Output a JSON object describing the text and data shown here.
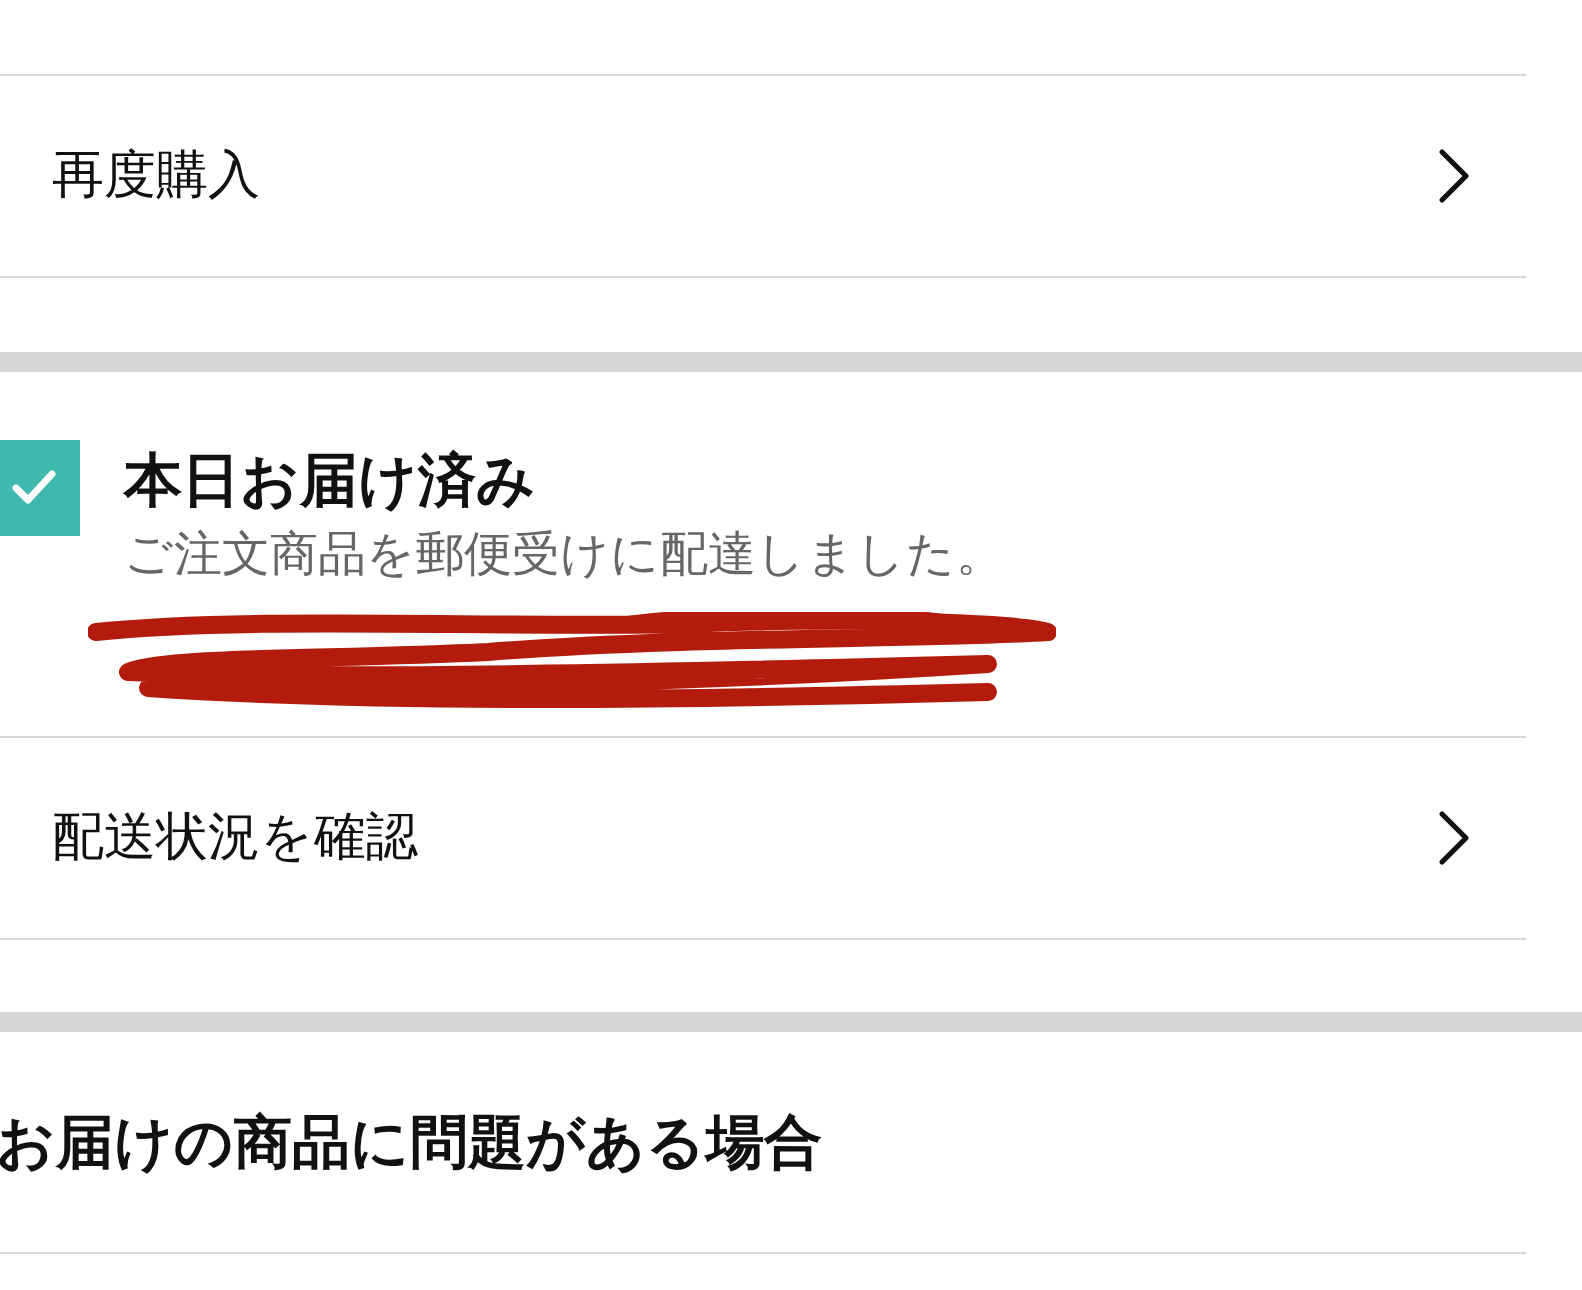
{
  "reorder_row": {
    "label": "再度購入"
  },
  "delivery": {
    "checked": true,
    "title": "本日お届け済み",
    "message": "ご注文商品を郵便受けに配達しました。"
  },
  "tracking_row": {
    "label": "配送状況を確認"
  },
  "problem_section": {
    "heading": "お届けの商品に問題がある場合"
  }
}
